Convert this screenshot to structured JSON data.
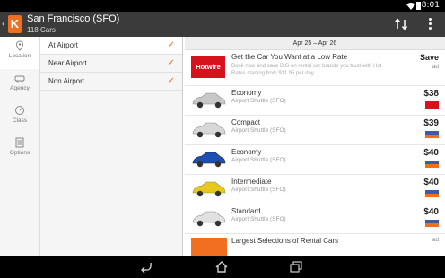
{
  "status": {
    "time": "8:01"
  },
  "header": {
    "logo_letter": "K",
    "title": "San Francisco (SFO)",
    "subtitle": "118 Cars",
    "back": "‹"
  },
  "rail": [
    {
      "label": "Location",
      "icon": "location-pin-icon"
    },
    {
      "label": "Agency",
      "icon": "car-icon"
    },
    {
      "label": "Class",
      "icon": "gauge-icon"
    },
    {
      "label": "Options",
      "icon": "checklist-icon"
    }
  ],
  "filters": [
    {
      "label": "At Airport",
      "checked": true
    },
    {
      "label": "Near Airport",
      "checked": true
    },
    {
      "label": "Non Airport",
      "checked": true
    }
  ],
  "list": {
    "date_range": "Apr 25 – Apr 26",
    "ad": {
      "brand": "Hotwire",
      "title": "Get the Car You Want at a Low Rate",
      "desc": "Book now and save BIG on rental car brands you trust with Hot Rates starting from $11.95 per day",
      "cta": "Save",
      "ad_label": "ad"
    },
    "cars": [
      {
        "name": "Economy",
        "location": "Airport Shuttle (SFO)",
        "price": "$38",
        "color": "#c8c8c8"
      },
      {
        "name": "Compact",
        "location": "Airport Shuttle (SFO)",
        "price": "$39",
        "color": "#d8d8d8"
      },
      {
        "name": "Economy",
        "location": "Airport Shuttle (SFO)",
        "price": "$40",
        "color": "#1f4fb0"
      },
      {
        "name": "Intermediate",
        "location": "Airport Shuttle (SFO)",
        "price": "$40",
        "color": "#e8c81a"
      },
      {
        "name": "Standard",
        "location": "Airport Shuttle (SFO)",
        "price": "$40",
        "color": "#e0e0e0"
      }
    ],
    "bottom_ad": {
      "title": "Largest Selections of Rental Cars",
      "ad_label": "ad"
    }
  }
}
